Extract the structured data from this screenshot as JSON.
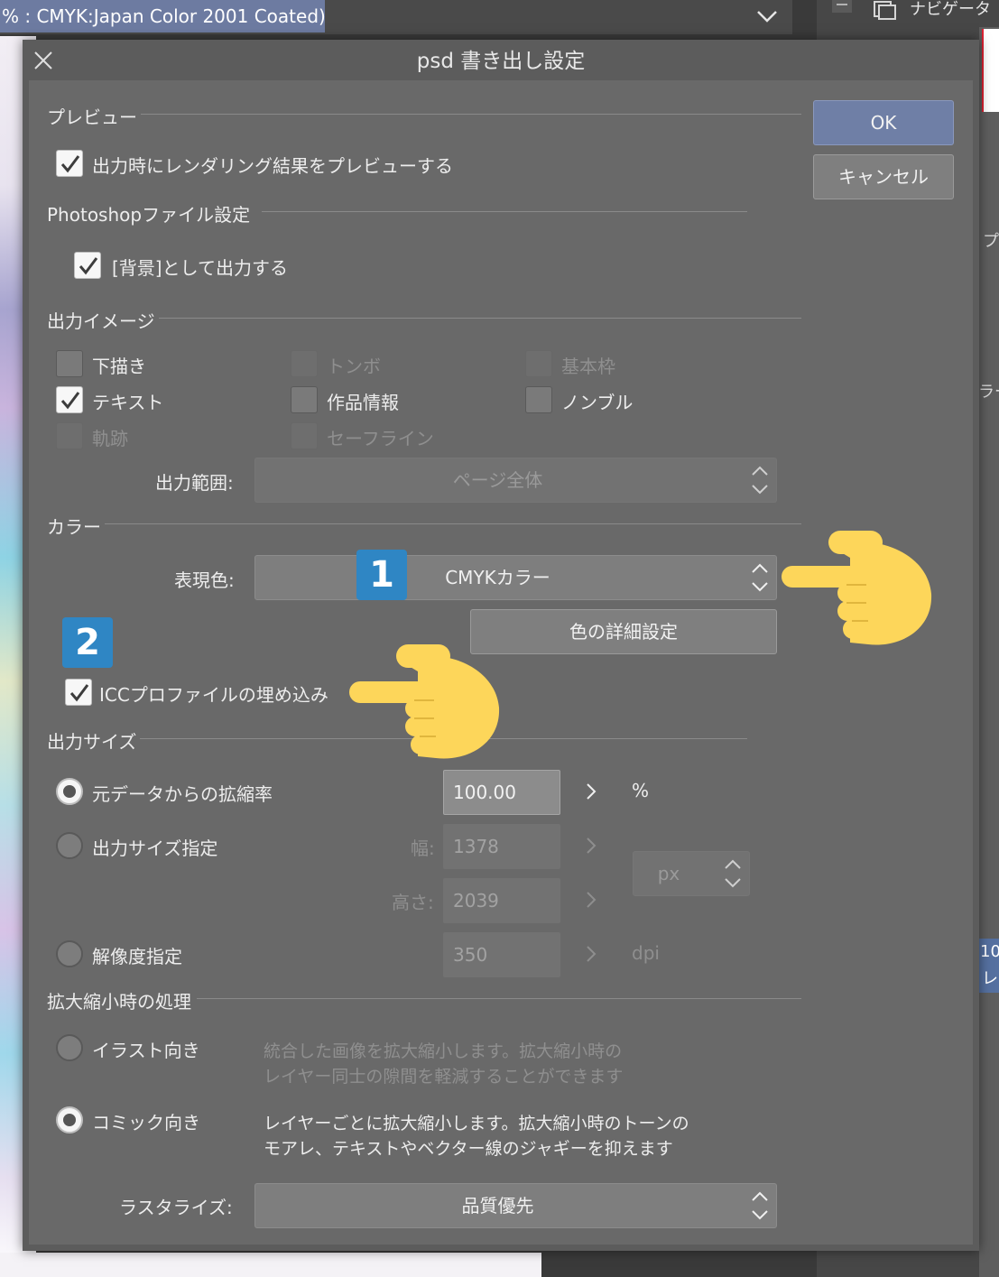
{
  "background": {
    "profile_text": "% : CMYK:Japan Color 2001 Coated)",
    "navigator_label": "ナビゲータ",
    "side_text_1": "プ",
    "side_text_2": "ラー",
    "side_text_3": "10",
    "side_text_4": "レ"
  },
  "dialog": {
    "title": "psd 書き出し設定",
    "ok_label": "OK",
    "cancel_label": "キャンセル"
  },
  "preview": {
    "section_title": "プレビュー",
    "render_preview_label": "出力時にレンダリング結果をプレビューする"
  },
  "photoshop": {
    "section_title": "Photoshopファイル設定",
    "background_label": "[背景]として出力する"
  },
  "output_image": {
    "section_title": "出力イメージ",
    "options": [
      {
        "label": "下描き",
        "checked": false,
        "enabled": true
      },
      {
        "label": "トンボ",
        "checked": false,
        "enabled": false
      },
      {
        "label": "基本枠",
        "checked": false,
        "enabled": false
      },
      {
        "label": "テキスト",
        "checked": true,
        "enabled": true
      },
      {
        "label": "作品情報",
        "checked": false,
        "enabled": true
      },
      {
        "label": "ノンブル",
        "checked": false,
        "enabled": true
      },
      {
        "label": "軌跡",
        "checked": false,
        "enabled": false
      },
      {
        "label": "セーフライン",
        "checked": false,
        "enabled": false
      }
    ],
    "range_label": "出力範囲:",
    "range_value": "ページ全体"
  },
  "color": {
    "section_title": "カラー",
    "mode_label": "表現色:",
    "mode_value": "CMYKカラー",
    "details_button": "色の詳細設定",
    "icc_label": "ICCプロファイルの埋め込み",
    "badge_1": "1",
    "badge_2": "2"
  },
  "output_size": {
    "section_title": "出力サイズ",
    "scale_label": "元データからの拡縮率",
    "scale_value": "100.00",
    "scale_unit": "%",
    "size_label": "出力サイズ指定",
    "width_label": "幅:",
    "width_value": "1378",
    "height_label": "高さ:",
    "height_value": "2039",
    "size_unit": "px",
    "resolution_label": "解像度指定",
    "resolution_value": "350",
    "resolution_unit": "dpi"
  },
  "scaling": {
    "section_title": "拡大縮小時の処理",
    "illust_label": "イラスト向き",
    "illust_desc_1": "統合した画像を拡大縮小します。拡大縮小時の",
    "illust_desc_2": "レイヤー同士の隙間を軽減することができます",
    "comic_label": "コミック向き",
    "comic_desc_1": "レイヤーごとに拡大縮小します。拡大縮小時のトーンの",
    "comic_desc_2": "モアレ、テキストやベクター線のジャギーを抑えます",
    "rasterize_label": "ラスタライズ:",
    "rasterize_value": "品質優先"
  },
  "colors": {
    "dialog_bg": "#696969",
    "ok_button": "#6f7fa6",
    "badge": "#2f86c4",
    "pointer_hand": "#fdd65a"
  },
  "icons": [
    "close-icon",
    "check-icon",
    "chevron-down-icon",
    "up-down-arrows-icon",
    "chevron-right-icon",
    "pointing-hand-icon"
  ]
}
